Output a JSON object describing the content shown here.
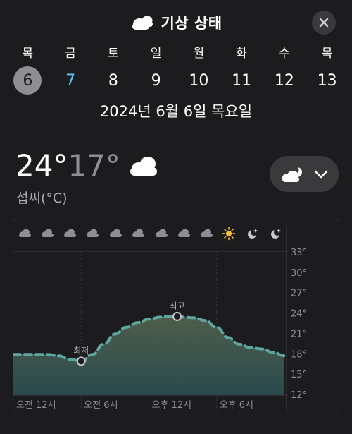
{
  "header": {
    "title": "기상 상태",
    "icon": "cloud-icon",
    "close_icon": "close-icon"
  },
  "days": [
    {
      "dow": "목",
      "date": "6",
      "state": "selected"
    },
    {
      "dow": "금",
      "date": "7",
      "state": "today"
    },
    {
      "dow": "토",
      "date": "8",
      "state": ""
    },
    {
      "dow": "일",
      "date": "9",
      "state": ""
    },
    {
      "dow": "월",
      "date": "10",
      "state": ""
    },
    {
      "dow": "화",
      "date": "11",
      "state": ""
    },
    {
      "dow": "수",
      "date": "12",
      "state": ""
    },
    {
      "dow": "목",
      "date": "13",
      "state": ""
    }
  ],
  "full_date": "2024년 6월 6일 목요일",
  "summary": {
    "high": "24°",
    "low": "17°",
    "unit": "섭씨(°C)",
    "condition_icon": "cloud-icon"
  },
  "picker": {
    "icon": "cloud-moon-icon",
    "chevron": "chevron-down-icon"
  },
  "chart_data": {
    "type": "line",
    "hourly_icons": [
      "cloud",
      "cloud",
      "cloud",
      "cloud",
      "cloud",
      "cloud",
      "cloud",
      "cloud",
      "cloud",
      "sun",
      "moon-clear",
      "moon-clear"
    ],
    "x_labels": [
      "오전 12시",
      "오전 6시",
      "오후 12시",
      "오후 6시"
    ],
    "y_ticks": [
      "33°",
      "30°",
      "27°",
      "24°",
      "21°",
      "18°",
      "15°",
      "12°"
    ],
    "ylim": [
      12,
      33
    ],
    "xlim": [
      0,
      24
    ],
    "series": [
      {
        "x": [
          0,
          1,
          2,
          3,
          4,
          5,
          6,
          7,
          8,
          9,
          10,
          11,
          12,
          13,
          14,
          15,
          16,
          17,
          18,
          19,
          20,
          21,
          22,
          23,
          24
        ],
        "y": [
          18,
          18,
          18,
          18,
          17.8,
          17.3,
          17,
          18,
          19.5,
          21,
          22,
          22.7,
          23.2,
          23.5,
          23.6,
          23.5,
          23.4,
          23,
          22,
          20.5,
          19.5,
          19,
          18.8,
          18.3,
          17.8
        ]
      }
    ],
    "markers": [
      {
        "label": "최저",
        "x": 6,
        "y": 17
      },
      {
        "label": "최고",
        "x": 14.5,
        "y": 23.6
      }
    ],
    "colors": {
      "line": "#5fa6a1",
      "fill_top": "#4e5e4a",
      "fill_bottom": "#294a4e",
      "grid": "#3a3a3c",
      "label": "#8e8e93"
    }
  }
}
